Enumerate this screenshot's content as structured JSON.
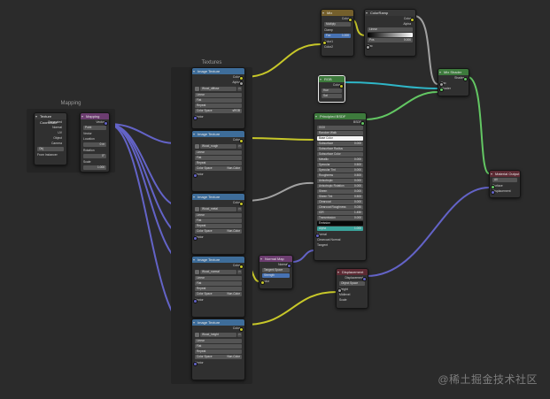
{
  "frames": {
    "mapping_label": "Mapping",
    "textures_label": "Textures"
  },
  "texcoord": {
    "title": "Texture Coordinate",
    "outputs": [
      "Generated",
      "Normal",
      "UV",
      "Object",
      "Camera",
      "Window",
      "Reflection"
    ],
    "object_label": "Obj",
    "instancer": "From Instancer"
  },
  "mapping": {
    "title": "Mapping",
    "vector_out": "Vector",
    "type_label": "Type",
    "type_value": "Point",
    "vector_in": "Vector",
    "location": "Location",
    "rotation": "Rotation",
    "scale": "Scale",
    "x": "X",
    "y": "Y",
    "z": "Z",
    "loc_vals": [
      "0 m",
      "0 m",
      "0 m"
    ],
    "rot_vals": [
      "0°",
      "0°",
      "0°"
    ],
    "scale_vals": [
      "1.000",
      "1.000",
      "1.000"
    ]
  },
  "textures": [
    {
      "title": "Image Texture",
      "image": "Wood_diffuse",
      "linear": "Linear",
      "flat": "Flat",
      "repeat": "Repeat",
      "single": "Single Image",
      "colorspace": "Color Space",
      "cs_val": "sRGB",
      "alpha": "Alpha",
      "alpha_val": "Straight",
      "vector": "Vector",
      "out_color": "Color",
      "out_alpha": "Alpha"
    },
    {
      "title": "Image Texture",
      "image": "Wood_rough",
      "linear": "Linear",
      "flat": "Flat",
      "repeat": "Repeat",
      "single": "Single Image",
      "colorspace": "Color Space",
      "cs_val": "Non-Color",
      "alpha": "Alpha",
      "alpha_val": "Straight",
      "vector": "Vector",
      "out_color": "Color",
      "out_alpha": "Alpha"
    },
    {
      "title": "Image Texture",
      "image": "Wood_metal",
      "linear": "Linear",
      "flat": "Flat",
      "repeat": "Repeat",
      "single": "Single Image",
      "colorspace": "Color Space",
      "cs_val": "Non-Color",
      "alpha": "Alpha",
      "alpha_val": "Straight",
      "vector": "Vector",
      "out_color": "Color",
      "out_alpha": "Alpha"
    },
    {
      "title": "Image Texture",
      "image": "Wood_normal",
      "linear": "Linear",
      "flat": "Flat",
      "repeat": "Repeat",
      "single": "Single Image",
      "colorspace": "Color Space",
      "cs_val": "Non-Color",
      "alpha": "Alpha",
      "alpha_val": "Straight",
      "vector": "Vector",
      "out_color": "Color",
      "out_alpha": "Alpha"
    },
    {
      "title": "Image Texture",
      "image": "Wood_height",
      "linear": "Linear",
      "flat": "Flat",
      "repeat": "Repeat",
      "single": "Single Image",
      "colorspace": "Color Space",
      "cs_val": "Non-Color",
      "alpha": "Alpha",
      "alpha_val": "Straight",
      "vector": "Vector",
      "out_color": "Color",
      "out_alpha": "Alpha"
    }
  ],
  "mixrgb": {
    "title": "Mix",
    "out": "Color",
    "mode": "Multiply",
    "clamp": "Clamp",
    "fac": "Fac",
    "fac_val": "1.000",
    "color1": "Color1",
    "color2": "Color2"
  },
  "colorramp": {
    "title": "ColorRamp",
    "out_color": "Color",
    "out_alpha": "Alpha",
    "rgb": "RGB",
    "linear": "Linear",
    "pos": "Pos",
    "pos_val": "0.000",
    "fac": "Fac"
  },
  "rgbnode": {
    "title": "RGB",
    "out": "Color",
    "hue": "Hue",
    "sat": "Sat",
    "val": "Val"
  },
  "principled": {
    "title": "Principled BSDF",
    "out": "BSDF",
    "dist": "GGX",
    "sss_method": "Random Walk",
    "inputs": [
      "Base Color",
      "Subsurface",
      "Subsurface Radius",
      "Subsurface Color",
      "Metallic",
      "Specular",
      "Specular Tint",
      "Roughness",
      "Anisotropic",
      "Anisotropic Rotation",
      "Sheen",
      "Sheen Tint",
      "Clearcoat",
      "Clearcoat Roughness",
      "IOR",
      "Transmission",
      "Transmission Roughness",
      "Emission",
      "Emission Strength",
      "Alpha",
      "Normal",
      "Clearcoat Normal",
      "Tangent"
    ],
    "values": [
      "",
      "0.000",
      "",
      "",
      "0.000",
      "0.500",
      "0.000",
      "0.500",
      "0.000",
      "0.000",
      "0.000",
      "0.500",
      "0.000",
      "0.030",
      "1.450",
      "0.000",
      "0.000",
      "",
      "1.000",
      "1.000",
      "",
      "",
      ""
    ]
  },
  "bump": {
    "title": "Bump",
    "out": "Normal",
    "invert": "Invert",
    "strength": "Strength",
    "strength_val": "1.000",
    "distance": "Distance",
    "distance_val": "1.000",
    "height": "Height",
    "normal": "Normal"
  },
  "normalmap": {
    "title": "Normal Map",
    "out": "Normal",
    "space": "Tangent Space",
    "strength": "Strength",
    "strength_val": "1.000",
    "color": "Color"
  },
  "displacement": {
    "title": "Displacement",
    "out": "Displacement",
    "space": "Object Space",
    "height": "Height",
    "midlevel": "Midlevel",
    "scale": "Scale",
    "normal": "Normal"
  },
  "mixshader": {
    "title": "Mix Shader",
    "out": "Shader",
    "fac": "Fac",
    "shader1": "Shader",
    "shader2": "Shader"
  },
  "output": {
    "title": "Material Output",
    "target": "All",
    "surface": "Surface",
    "volume": "Volume",
    "displacement": "Displacement"
  },
  "watermark": "@稀土掘金技术社区"
}
